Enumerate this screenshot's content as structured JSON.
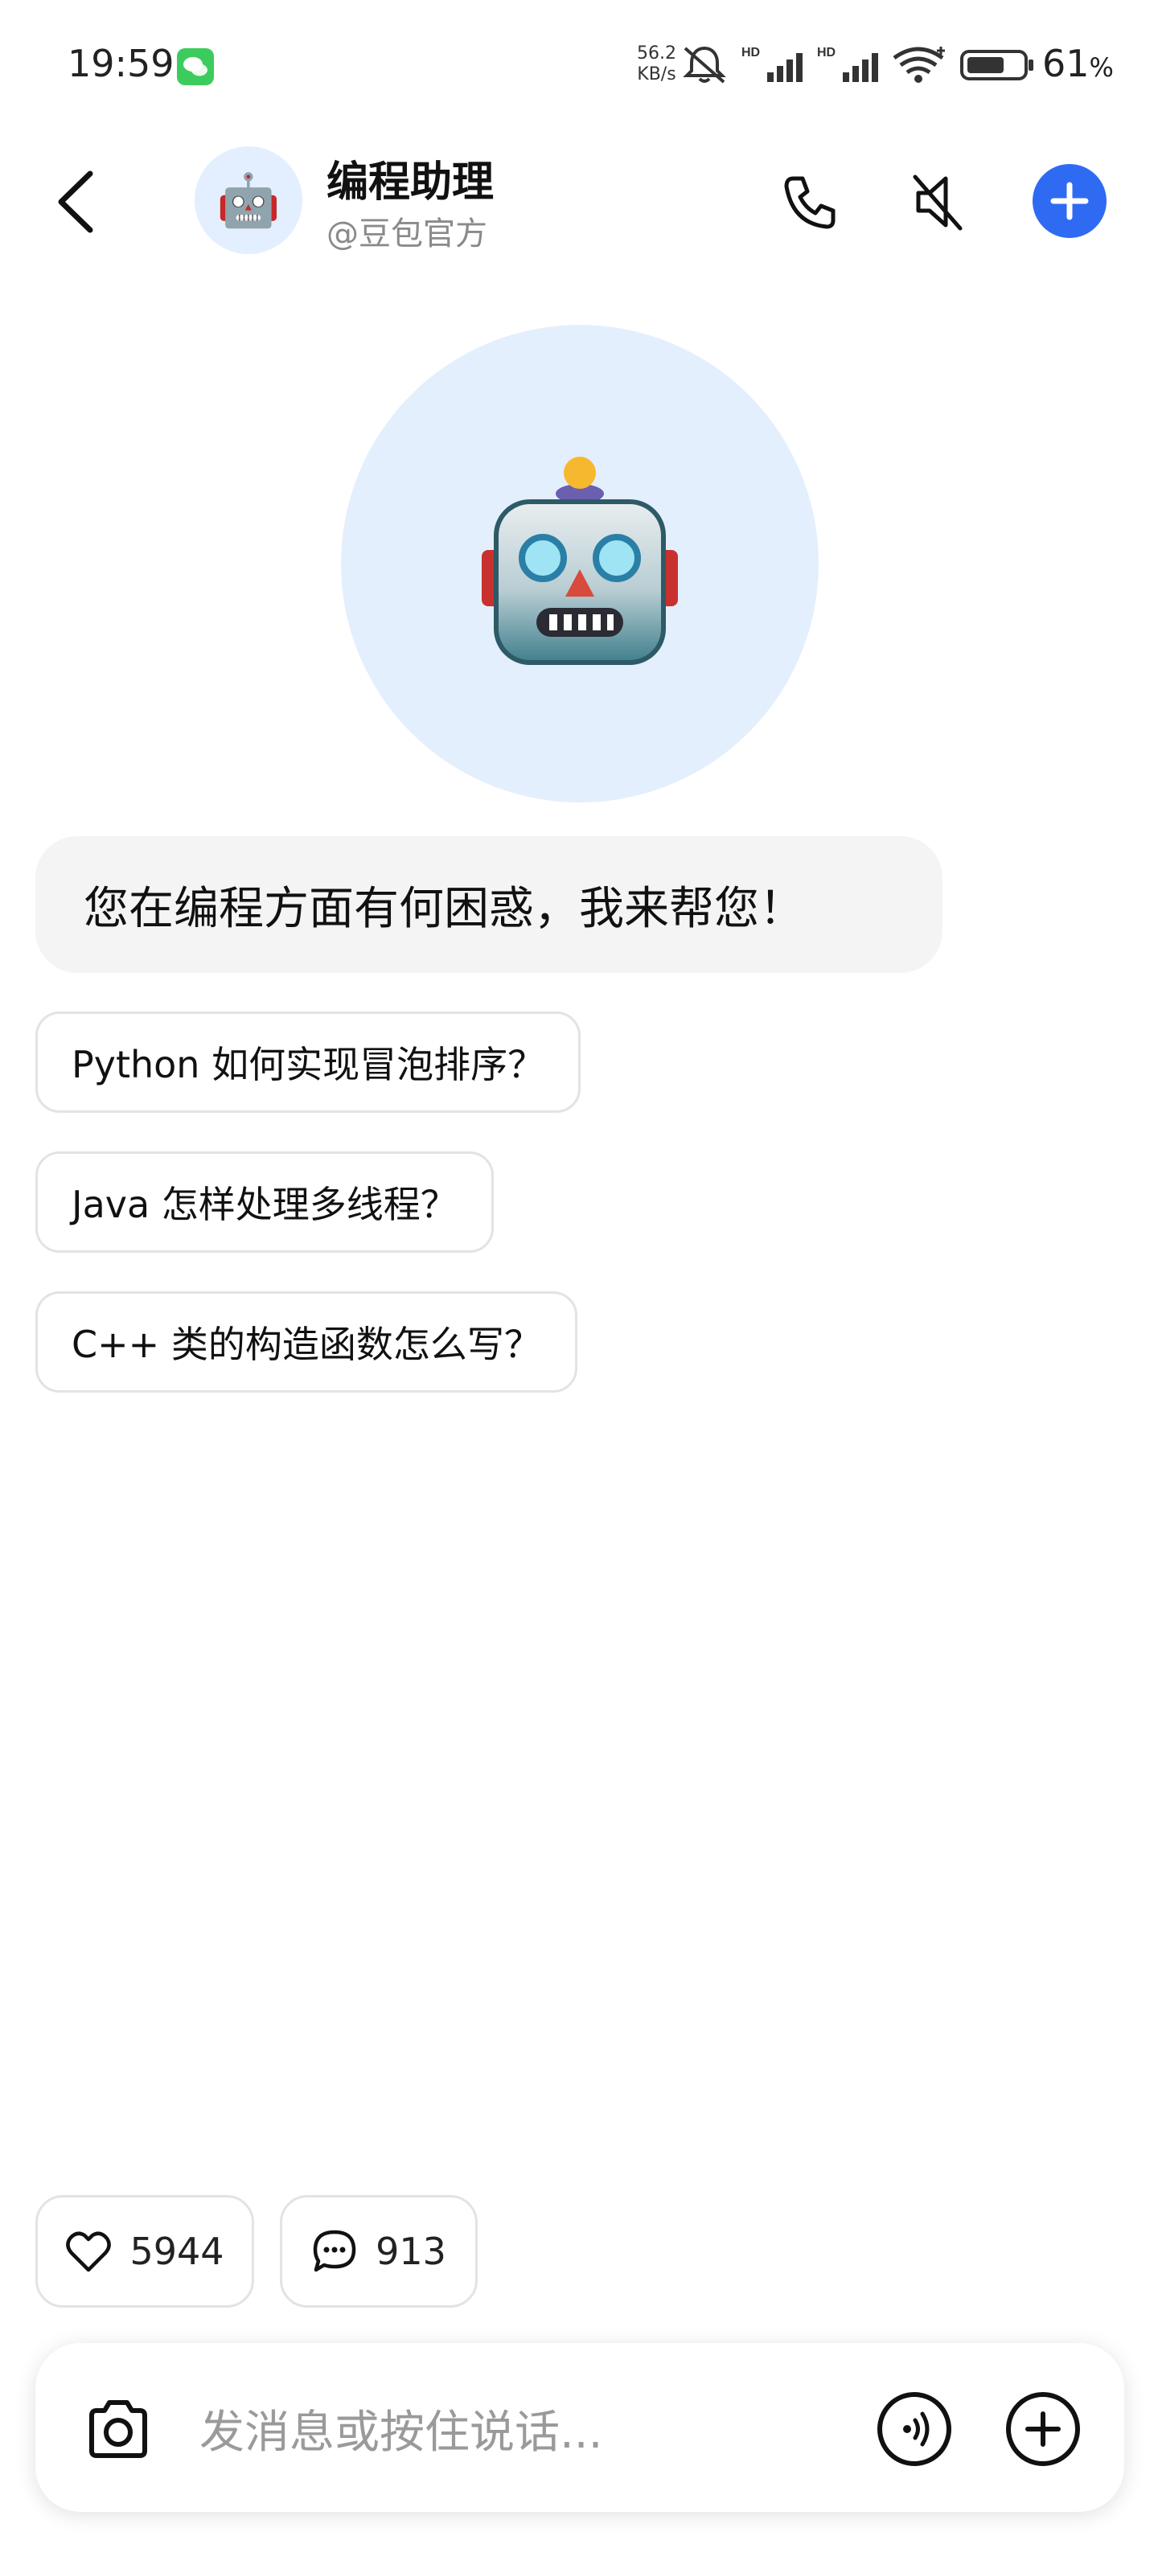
{
  "status_bar": {
    "time": "19:59",
    "net_speed_value": "56.2",
    "net_speed_unit": "KB/s",
    "battery": "61",
    "battery_unit": "%",
    "icons": [
      "wechat-icon",
      "mute-bell-icon",
      "hd-signal-icon",
      "hd-signal-icon",
      "wifi-icon",
      "battery-icon"
    ]
  },
  "header": {
    "name": "编程助理",
    "handle": "@豆包官方",
    "avatar_emoji": "🤖",
    "accent": "#2f6bf2"
  },
  "greeting": "您在编程方面有何困惑，我来帮您！",
  "suggestions": [
    "Python 如何实现冒泡排序？",
    "Java 怎样处理多线程？",
    "C++ 类的构造函数怎么写？"
  ],
  "stats": {
    "likes": "5944",
    "comments": "913"
  },
  "composer": {
    "placeholder": "发消息或按住说话..."
  }
}
